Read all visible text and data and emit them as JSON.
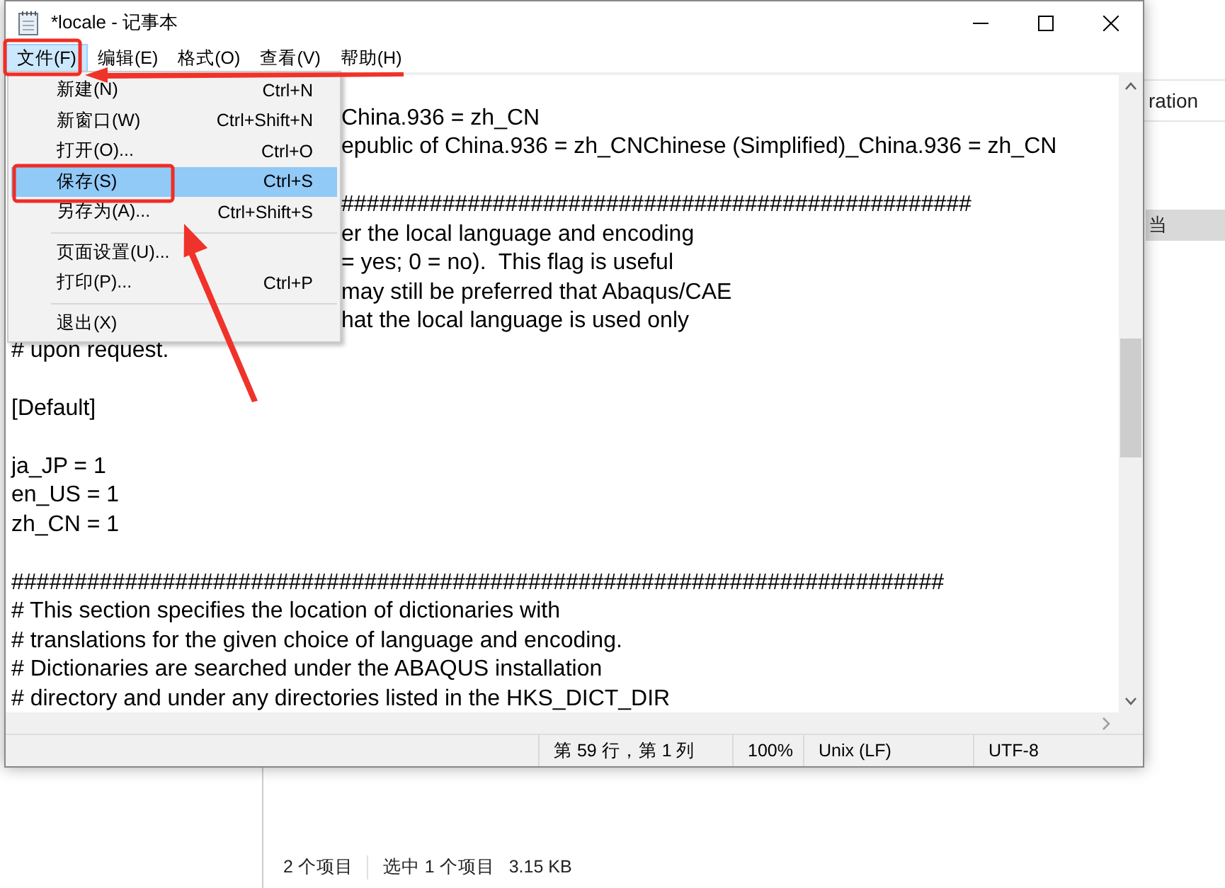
{
  "background_window": {
    "column_header": "ration",
    "selected_row": "当",
    "status_items": [
      "2 个项目",
      "选中 1 个项目",
      "3.15 KB"
    ]
  },
  "window": {
    "title": "*locale - 记事本"
  },
  "menu_bar": [
    {
      "label": "文件(F)",
      "selected": true
    },
    {
      "label": "编辑(E)",
      "selected": false
    },
    {
      "label": "格式(O)",
      "selected": false
    },
    {
      "label": "查看(V)",
      "selected": false
    },
    {
      "label": "帮助(H)",
      "selected": false
    }
  ],
  "file_menu": [
    {
      "kind": "item",
      "label": "新建(N)",
      "shortcut": "Ctrl+N",
      "selected": false
    },
    {
      "kind": "item",
      "label": "新窗口(W)",
      "shortcut": "Ctrl+Shift+N",
      "selected": false
    },
    {
      "kind": "item",
      "label": "打开(O)...",
      "shortcut": "Ctrl+O",
      "selected": false
    },
    {
      "kind": "item",
      "label": "保存(S)",
      "shortcut": "Ctrl+S",
      "selected": true
    },
    {
      "kind": "item",
      "label": "另存为(A)...",
      "shortcut": "Ctrl+Shift+S",
      "selected": false
    },
    {
      "kind": "separator"
    },
    {
      "kind": "item",
      "label": "页面设置(U)...",
      "selected": false
    },
    {
      "kind": "item",
      "label": "打印(P)...",
      "shortcut": "Ctrl+P",
      "selected": false
    },
    {
      "kind": "separator"
    },
    {
      "kind": "item",
      "label": "退出(X)",
      "selected": false
    }
  ],
  "editor": {
    "lines": [
      {
        "kind": "blank"
      },
      {
        "kind": "partial",
        "text": "China.936 = zh_CN"
      },
      {
        "kind": "partial",
        "text": "epublic of China.936 = zh_CNChinese (Simplified)_China.936 = zh_CN"
      },
      {
        "kind": "blank"
      },
      {
        "kind": "partial",
        "text": "##################################################"
      },
      {
        "kind": "partial",
        "text": "er the local language and encoding"
      },
      {
        "kind": "partial",
        "text": "= yes; 0 = no).  This flag is useful"
      },
      {
        "kind": "partial",
        "text": "may still be preferred that Abaqus/CAE"
      },
      {
        "kind": "partial",
        "text": "hat the local language is used only"
      },
      {
        "kind": "full",
        "text": "# upon request."
      },
      {
        "kind": "blank"
      },
      {
        "kind": "full",
        "text": "[Default]"
      },
      {
        "kind": "blank"
      },
      {
        "kind": "full",
        "text": "ja_JP = 1"
      },
      {
        "kind": "full",
        "text": "en_US = 1"
      },
      {
        "kind": "full",
        "text": "zh_CN = 1"
      },
      {
        "kind": "blank"
      },
      {
        "kind": "full",
        "text": "##########################################################################"
      },
      {
        "kind": "full",
        "text": "# This section specifies the location of dictionaries with"
      },
      {
        "kind": "full",
        "text": "# translations for the given choice of language and encoding."
      },
      {
        "kind": "full",
        "text": "# Dictionaries are searched under the ABAQUS installation"
      },
      {
        "kind": "full",
        "text": "# directory and under any directories listed in the HKS_DICT_DIR"
      }
    ]
  },
  "status_bar": [
    "第 59 行，第 1 列",
    "100%",
    "Unix (LF)",
    "UTF-8"
  ]
}
